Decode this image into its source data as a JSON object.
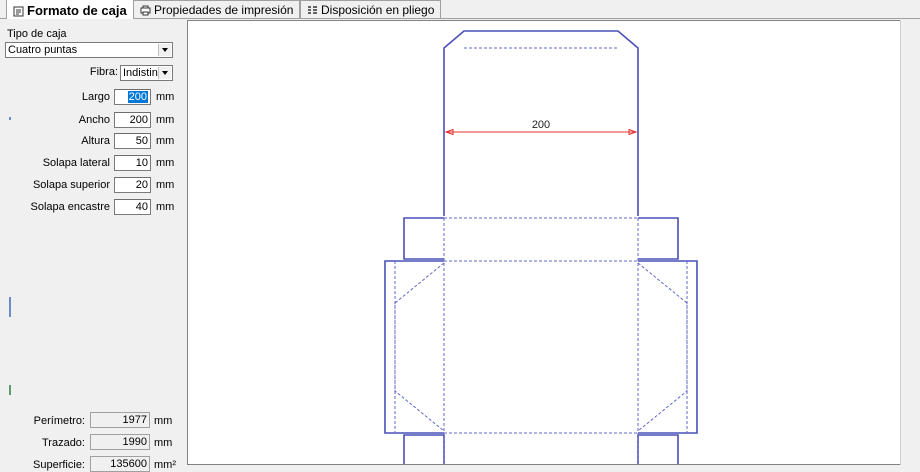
{
  "tabs": [
    {
      "label": "Formato de caja",
      "icon": "box-format-icon"
    },
    {
      "label": "Propiedades de impresión",
      "icon": "print-properties-icon"
    },
    {
      "label": "Disposición en pliego",
      "icon": "sheet-layout-icon"
    }
  ],
  "panel": {
    "box_type_label": "Tipo de caja",
    "box_type_value": "Cuatro puntas",
    "fiber_label": "Fibra:",
    "fiber_value": "Indistinta",
    "fields": [
      {
        "label": "Largo",
        "value": "200",
        "unit": "mm"
      },
      {
        "label": "Ancho",
        "value": "200",
        "unit": "mm"
      },
      {
        "label": "Altura",
        "value": "50",
        "unit": "mm"
      },
      {
        "label": "Solapa lateral",
        "value": "10",
        "unit": "mm"
      },
      {
        "label": "Solapa superior",
        "value": "20",
        "unit": "mm"
      },
      {
        "label": "Solapa encastre",
        "value": "40",
        "unit": "mm"
      }
    ],
    "results": [
      {
        "label": "Perímetro:",
        "value": "1977",
        "unit": "mm"
      },
      {
        "label": "Trazado:",
        "value": "1990",
        "unit": "mm"
      },
      {
        "label": "Superficie:",
        "value": "135600",
        "unit": "mm²"
      }
    ]
  },
  "drawing": {
    "dimension_label": "200",
    "colors": {
      "cut": "#4a50b8",
      "fold": "#6068c8",
      "dimension": "#e03030"
    }
  }
}
